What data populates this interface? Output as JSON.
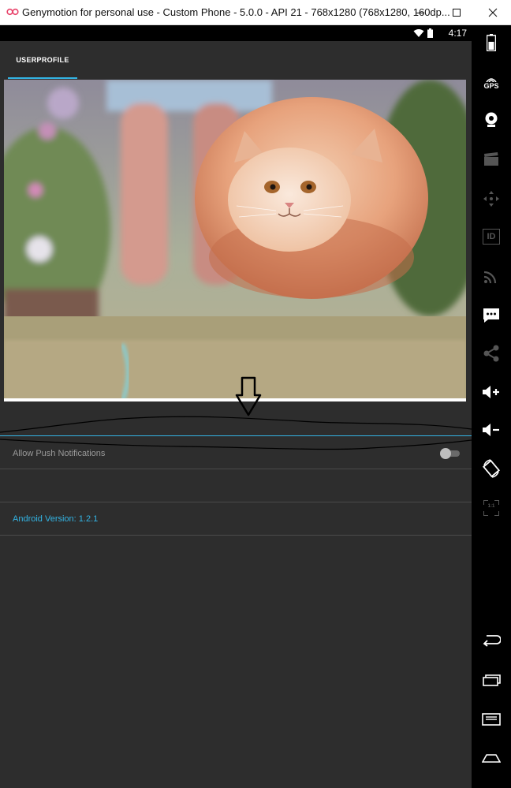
{
  "window": {
    "title": "Genymotion for personal use - Custom Phone - 5.0.0 - API 21 - 768x1280 (768x1280, 160dp...",
    "minimize_glyph": "–",
    "maximize_glyph": "☐",
    "close_glyph": "✕"
  },
  "statusbar": {
    "time": "4:17"
  },
  "tabs": [
    {
      "label": "USERPROFILE",
      "selected": true
    }
  ],
  "settings": {
    "push_notifications": {
      "label": "Allow Push Notifications",
      "enabled": false
    },
    "version_label": "Android Version: 1.2.1"
  },
  "sidebar": {
    "gps_label": "GPS",
    "id_label": "ID",
    "scale_label": "1:1"
  },
  "colors": {
    "accent": "#33b5e5",
    "background": "#2d2d2d",
    "sidebar": "#000000",
    "divider": "#4a4a4a",
    "text_secondary": "#9a9a9a"
  },
  "icons": [
    "genymotion-logo-icon",
    "wifi-icon",
    "battery-icon",
    "gps-icon",
    "webcam-icon",
    "clapperboard-icon",
    "dpad-icon",
    "id-icon",
    "cast-icon",
    "sms-icon",
    "share-icon",
    "volume-up-icon",
    "volume-down-icon",
    "rotate-icon",
    "scale-icon",
    "back-icon",
    "recent-apps-icon",
    "menu-icon",
    "home-icon",
    "down-arrow-annotation-icon"
  ]
}
